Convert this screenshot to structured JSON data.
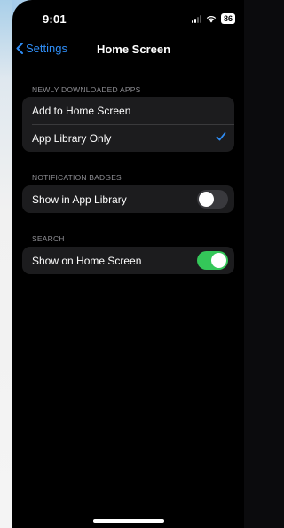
{
  "status_bar": {
    "time": "9:01",
    "battery": "86"
  },
  "nav": {
    "back_label": "Settings",
    "title": "Home Screen"
  },
  "sections": {
    "downloads": {
      "header": "NEWLY DOWNLOADED APPS",
      "options": [
        {
          "label": "Add to Home Screen",
          "selected": false
        },
        {
          "label": "App Library Only",
          "selected": true
        }
      ]
    },
    "badges": {
      "header": "NOTIFICATION BADGES",
      "row_label": "Show in App Library",
      "toggle_on": false
    },
    "search": {
      "header": "SEARCH",
      "row_label": "Show on Home Screen",
      "toggle_on": true
    }
  },
  "colors": {
    "accent": "#2f8df5",
    "toggle_on": "#34c759",
    "toggle_off": "#39393d",
    "group_bg": "#1c1c1e"
  }
}
